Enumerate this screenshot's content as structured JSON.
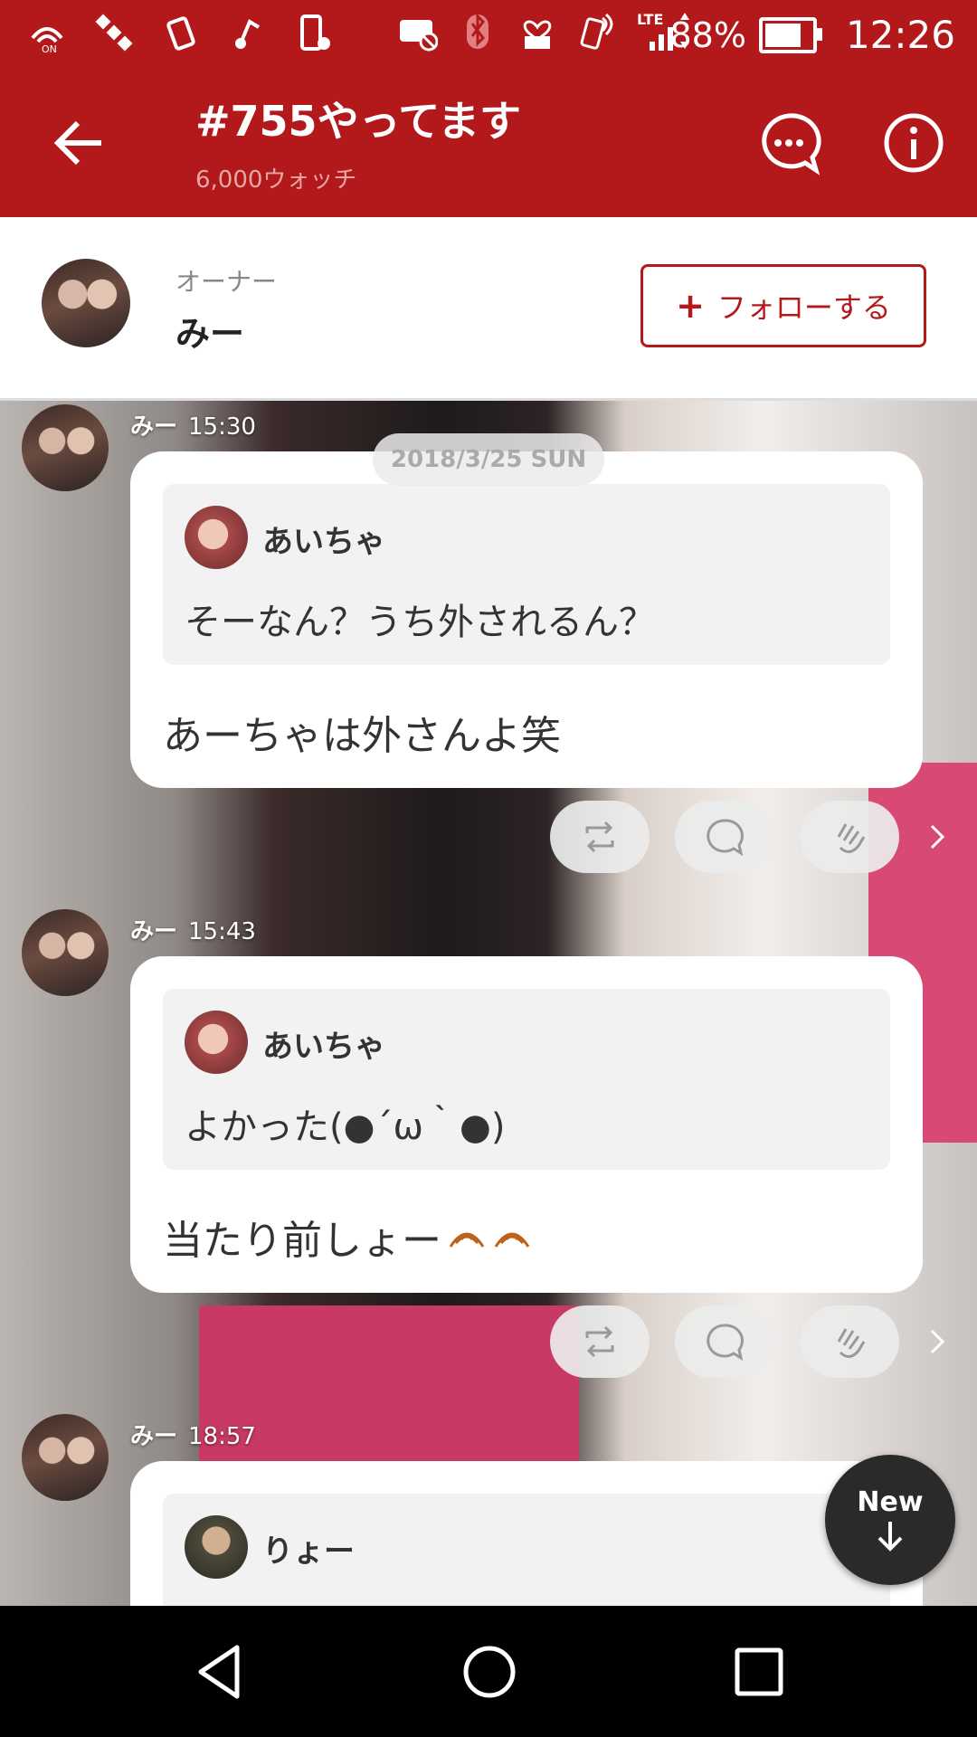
{
  "status_bar": {
    "battery_percent": "88%",
    "battery_level": 0.88,
    "time": "12:26",
    "left_icons": [
      "wifi-calling-icon",
      "satellite-icon",
      "vibrate-icon",
      "music-icon",
      "settings-phone-icon"
    ],
    "right_icons": [
      "voicemail-off-icon",
      "bluetooth-icon",
      "heart-mail-icon",
      "nfc-icon",
      "lte-signal-icon"
    ],
    "lte_label": "LTE"
  },
  "app_bar": {
    "title": "#755やってます",
    "subtitle": "6,000ウォッチ"
  },
  "owner": {
    "label": "オーナー",
    "name": "みー",
    "follow_label": "フォローする",
    "follow_icon": "+"
  },
  "timeline": {
    "date_pill": "2018/3/25 SUN",
    "messages": [
      {
        "author": "みー",
        "time": "15:30",
        "quote": {
          "name": "あいちゃ",
          "text": "そーなん？うち外されるん？"
        },
        "text": "あーちゃは外さんよ笑"
      },
      {
        "author": "みー",
        "time": "15:43",
        "quote": {
          "name": "あいちゃ",
          "text": "よかった(●´ω｀●)"
        },
        "text": "当たり前しょー"
      },
      {
        "author": "みー",
        "time": "18:57",
        "quote": {
          "name": "りょー",
          "text": ""
        },
        "text": ""
      }
    ],
    "new_button_label": "New"
  },
  "colors": {
    "brand_red": "#b3181a",
    "bubble_white": "#ffffff",
    "quote_gray": "#f2f2f2"
  }
}
